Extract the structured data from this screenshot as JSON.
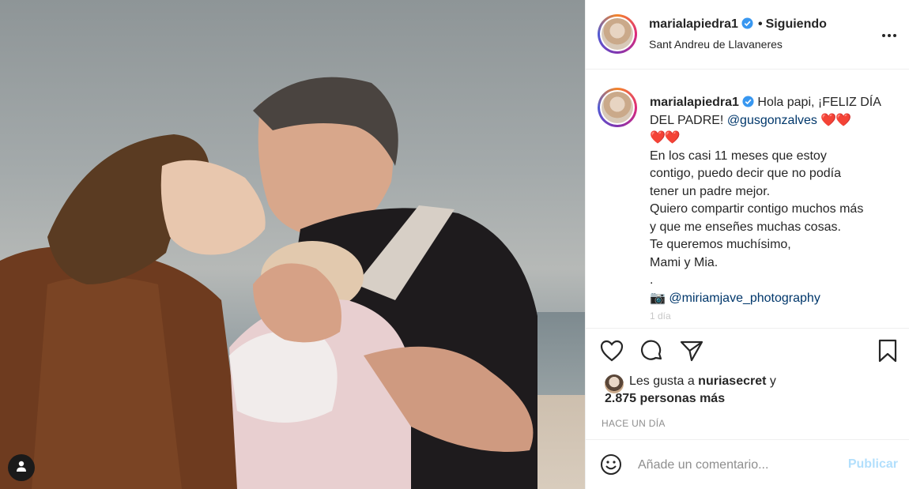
{
  "post": {
    "username": "marialapiedra1",
    "verified": true,
    "follow_status": "Siguiendo",
    "location": "Sant Andreu de Llavaneres",
    "photo_alt": "Foto familiar en la playa",
    "caption": {
      "greeting": "Hola papi, ¡FELIZ DÍA DEL PADRE! ",
      "mention": "@gusgonzalves",
      "hearts1": "❤️❤️",
      "hearts2": "❤️❤️",
      "lines": [
        "En los casi 11 meses que estoy",
        "contigo, puedo decir que no podía",
        "tener un padre mejor.",
        "Quiero compartir contigo muchos más",
        "y que me enseñes muchas cosas.",
        "Te queremos muchísimo,",
        "Mami y Mia.",
        "."
      ],
      "photo_credit_icon": "📷",
      "photo_credit": "@miriamjave_photography",
      "faded_text": "1 día"
    },
    "likes": {
      "prefix": "Les gusta a ",
      "liker": "nuriasecret",
      "joiner": " y",
      "others": "2.875 personas más"
    },
    "timestamp": "HACE UN DÍA",
    "comment": {
      "placeholder": "Añade un comentario...",
      "publish_label": "Publicar"
    },
    "icons": {
      "like": "heart-icon",
      "comment": "comment-icon",
      "share": "share-icon",
      "save": "bookmark-icon",
      "more": "more-options-icon",
      "emoji": "emoji-icon",
      "user_tag": "user-tag-icon"
    },
    "colors": {
      "verified": "#3897f0",
      "mention": "#00376b",
      "publish_disabled": "#b2dffc",
      "hearts": "#c0182a"
    }
  }
}
